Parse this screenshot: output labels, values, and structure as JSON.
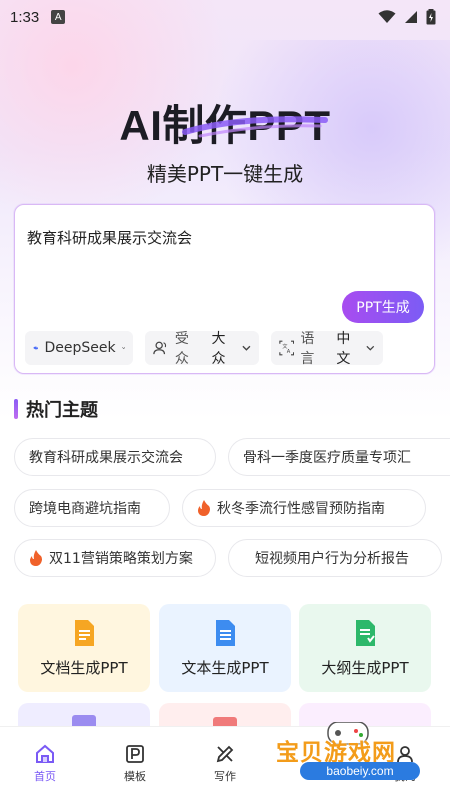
{
  "status_bar": {
    "time": "1:33",
    "badge": "A"
  },
  "hero": {
    "title": "AI制作PPT",
    "subtitle": "精美PPT一键生成"
  },
  "input": {
    "value": "教育科研成果展示交流会",
    "generate_label": "PPT生成"
  },
  "options": {
    "model": "DeepSeek",
    "audience_label": "受众",
    "audience_value": "大众",
    "language_label": "语言",
    "language_value": "中文"
  },
  "hot_topics": {
    "title": "热门主题",
    "chips": [
      "教育科研成果展示交流会",
      "骨科一季度医疗质量专项汇",
      "跨境电商避坑指南",
      "秋冬季流行性感冒预防指南",
      "双11营销策略策划方案",
      "短视频用户行为分析报告"
    ]
  },
  "features": [
    {
      "label": "文档生成PPT",
      "color": "#f5a623"
    },
    {
      "label": "文本生成PPT",
      "color": "#3d8cf0"
    },
    {
      "label": "大纲生成PPT",
      "color": "#2db86a"
    }
  ],
  "tabs": [
    {
      "label": "首页"
    },
    {
      "label": "模板"
    },
    {
      "label": "写作"
    },
    {
      "label": "我的"
    }
  ],
  "watermark": {
    "text": "宝贝游戏网",
    "url": "baobeiy.com"
  },
  "colors": {
    "accent": "#7a5af5",
    "hot_fire": "#f0612a"
  }
}
